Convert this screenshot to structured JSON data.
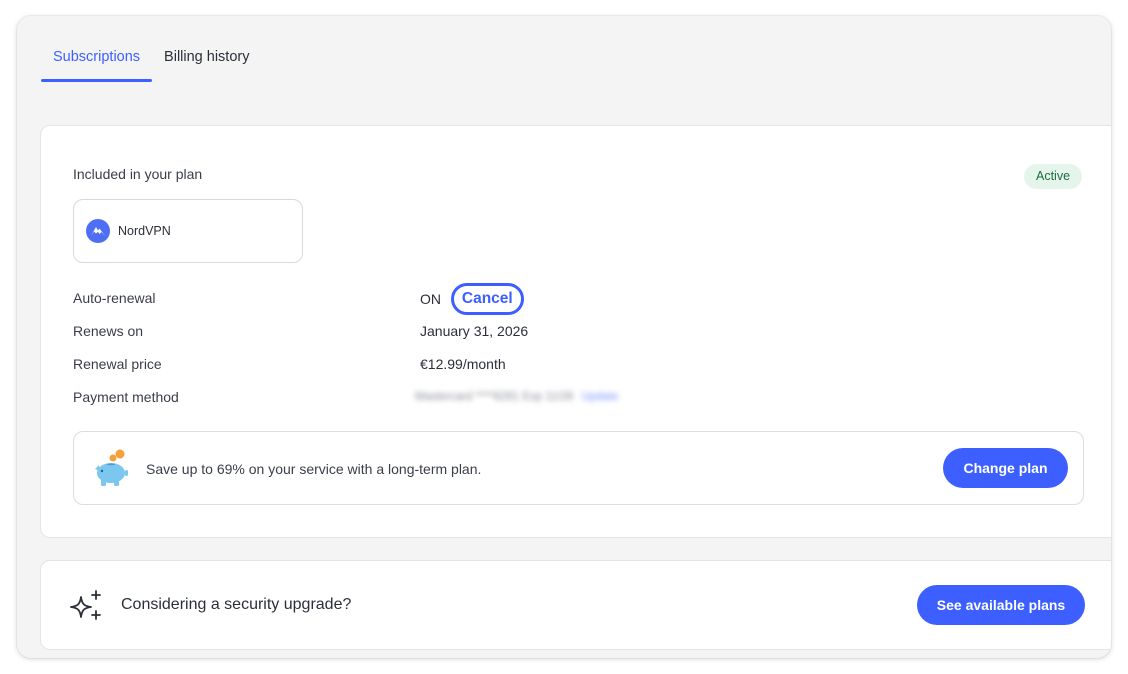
{
  "tabs": [
    {
      "label": "Subscriptions",
      "active": true
    },
    {
      "label": "Billing history",
      "active": false
    }
  ],
  "plan": {
    "included_label": "Included in your plan",
    "status": "Active",
    "product_name": "NordVPN",
    "rows": {
      "auto_renewal": {
        "label": "Auto-renewal",
        "value": "ON",
        "action": "Cancel"
      },
      "renews_on": {
        "label": "Renews on",
        "value": "January 31, 2026"
      },
      "renewal_price": {
        "label": "Renewal price",
        "value": "€12.99/month"
      },
      "payment_method": {
        "label": "Payment method",
        "value": "Mastercard ****8281 Exp 11/28",
        "action": "Update"
      }
    },
    "promo": {
      "text": "Save up to 69% on your service with a long-term plan.",
      "button": "Change plan"
    }
  },
  "upgrade": {
    "text": "Considering a security upgrade?",
    "button": "See available plans"
  },
  "colors": {
    "accent": "#3e5fff",
    "active_badge_bg": "#e6f5ec",
    "active_badge_text": "#1c6b3e"
  },
  "icons": [
    "nordvpn-logo-icon",
    "piggy-bank-icon",
    "sparkle-icon"
  ]
}
